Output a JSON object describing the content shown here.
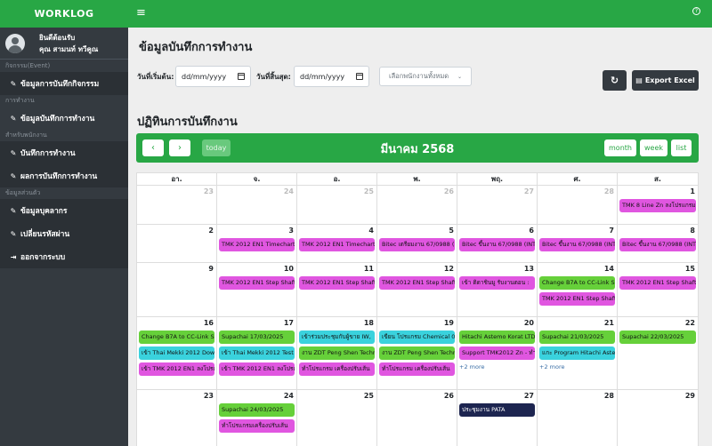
{
  "brand": "WORKLOG",
  "user": {
    "line1": "ยินดีต้อนรับ",
    "line2": "คุณ สามนท์ ทวีคูณ"
  },
  "sidebar": {
    "sec1": "กิจกรรม(Event)",
    "item1": "ข้อมูลการบันทึกกิจกรรม",
    "sec2": "การทำงาน",
    "item2": "ข้อมูลบันทึกการทำงาน",
    "sec3": "สำหรับพนักงาน",
    "item3": "บันทึกการทำงาน",
    "item4": "ผลการบันทึกการทำงาน",
    "sec4": "ข้อมูลส่วนตัว",
    "item5": "ข้อมูลบุคลากร",
    "item6": "เปลี่ยนรหัสผ่าน",
    "item7": "ออกจากระบบ"
  },
  "topbar": {
    "menu_icon": "hamburger-icon",
    "help_icon": "help-icon"
  },
  "page": {
    "title": "ข้อมูลบันทึกการทำงาน",
    "calendar_title": "ปฏิทินการบันทึกงาน"
  },
  "filters": {
    "start_label": "วันที่เริ่มต้น:",
    "end_label": "วันที่สิ้นสุด:",
    "start_placeholder": "dd/mm/yyyy",
    "end_placeholder": "dd/mm/yyyy",
    "employee_select": "เลือกพนักงานทั้งหมด",
    "export_label": "Export Excel"
  },
  "calendar": {
    "month_title": "มีนาคม 2568",
    "today_label": "today",
    "views": {
      "month": "month",
      "week": "week",
      "list": "list"
    },
    "weekdays": [
      "อา.",
      "จ.",
      "อ.",
      "พ.",
      "พฤ.",
      "ศ.",
      "ส."
    ],
    "colors": {
      "magenta": "#e056e0",
      "green": "#66d03a",
      "cyan": "#3ad2dd",
      "navy": "#1d2550"
    },
    "weeks": [
      {
        "days": [
          {
            "n": "23",
            "other": true
          },
          {
            "n": "24",
            "other": true
          },
          {
            "n": "25",
            "other": true
          },
          {
            "n": "26",
            "other": true
          },
          {
            "n": "27",
            "other": true
          },
          {
            "n": "28",
            "other": true
          },
          {
            "n": "1",
            "events": [
              {
                "t": "TMK 8 Line Zn ลงโปรแกรม",
                "c": "magenta"
              }
            ]
          }
        ]
      },
      {
        "days": [
          {
            "n": "2"
          },
          {
            "n": "3",
            "events": [
              {
                "t": "TMK 2012 EN1 Timechart",
                "c": "magenta"
              }
            ]
          },
          {
            "n": "4",
            "events": [
              {
                "t": "TMK 2012 EN1 Timechart",
                "c": "magenta"
              }
            ]
          },
          {
            "n": "5",
            "events": [
              {
                "t": "Bitec เตรียมงาน 67/0988 (",
                "c": "magenta"
              }
            ]
          },
          {
            "n": "6",
            "events": [
              {
                "t": "Bitec ขึ้นงาน 67/0988 (INT",
                "c": "magenta"
              }
            ]
          },
          {
            "n": "7",
            "events": [
              {
                "t": "Bitec ขึ้นงาน 67/0988 (INT",
                "c": "magenta"
              }
            ]
          },
          {
            "n": "8",
            "events": [
              {
                "t": "Bitec ขึ้นงาน 67/0988 (INT",
                "c": "magenta"
              }
            ]
          }
        ]
      },
      {
        "days": [
          {
            "n": "9"
          },
          {
            "n": "10",
            "events": [
              {
                "t": "TMK 2012 EN1 Step Shaft",
                "c": "magenta"
              }
            ]
          },
          {
            "n": "11",
            "events": [
              {
                "t": "TMK 2012 EN1 Step Shaft",
                "c": "magenta"
              }
            ]
          },
          {
            "n": "12",
            "events": [
              {
                "t": "TMK 2012 EN1 Step Shaft",
                "c": "magenta"
              }
            ]
          },
          {
            "n": "13",
            "events": [
              {
                "t": "เข้า ติดาชินมู รับงานตอน :",
                "c": "magenta"
              }
            ]
          },
          {
            "n": "14",
            "events": [
              {
                "t": "Change B7A to CC-Link Sy",
                "c": "green"
              },
              {
                "t": "TMK 2012 EN1 Step Shaft",
                "c": "magenta"
              }
            ]
          },
          {
            "n": "15",
            "events": [
              {
                "t": "TMK 2012 EN1 Step Shaft",
                "c": "magenta"
              }
            ]
          }
        ]
      },
      {
        "days": [
          {
            "n": "16",
            "events": [
              {
                "t": "Change B7A to CC-Link Sy",
                "c": "green"
              },
              {
                "t": "เข้า Thai Mekki 2012 Down",
                "c": "cyan"
              },
              {
                "t": "เข้า TMK 2012 EN1 ลงโปรแ",
                "c": "magenta"
              }
            ]
          },
          {
            "n": "17",
            "events": [
              {
                "t": "Supachai 17/03/2025",
                "c": "green"
              },
              {
                "t": "เข้า Thai Mekki 2012 Test l",
                "c": "cyan"
              },
              {
                "t": "เข้า TMK 2012 EN1 ลงโปรแ",
                "c": "magenta"
              }
            ]
          },
          {
            "n": "18",
            "events": [
              {
                "t": "เข้าร่วมประชุมกับผู้ขาย IW,",
                "c": "cyan"
              },
              {
                "t": "งาน ZDT Peng Shen Techn",
                "c": "green"
              },
              {
                "t": "ทำโปรแกรม เครื่องปรับเส้น",
                "c": "magenta"
              }
            ]
          },
          {
            "n": "19",
            "events": [
              {
                "t": "เขียน โปรแกรม Chemical 0",
                "c": "cyan"
              },
              {
                "t": "งาน ZDT Peng Shen Techn",
                "c": "green"
              },
              {
                "t": "ทำโปรแกรม เครื่องปรับเส้น",
                "c": "magenta"
              }
            ]
          },
          {
            "n": "20",
            "events": [
              {
                "t": "Hitachi Astemo Korat LTD.",
                "c": "green"
              },
              {
                "t": "Support TMK2012 Zn - ทำ",
                "c": "magenta"
              }
            ],
            "more": "+2 more"
          },
          {
            "n": "21",
            "events": [
              {
                "t": "Supachai 21/03/2025",
                "c": "green"
              },
              {
                "t": "แกะ Program Hitachi Aste",
                "c": "cyan"
              }
            ],
            "more": "+2 more"
          },
          {
            "n": "22",
            "events": [
              {
                "t": "Supachai 22/03/2025",
                "c": "green"
              }
            ]
          }
        ]
      },
      {
        "days": [
          {
            "n": "23"
          },
          {
            "n": "24",
            "events": [
              {
                "t": "Supachai 24/03/2025",
                "c": "green"
              },
              {
                "t": "ทำโปรแกรมเครื่องปรับเส้น",
                "c": "magenta"
              }
            ]
          },
          {
            "n": "25"
          },
          {
            "n": "26"
          },
          {
            "n": "27",
            "events": [
              {
                "t": "ประชุมงาน PATA",
                "c": "navy"
              }
            ]
          },
          {
            "n": "28"
          },
          {
            "n": "29"
          }
        ]
      }
    ]
  }
}
